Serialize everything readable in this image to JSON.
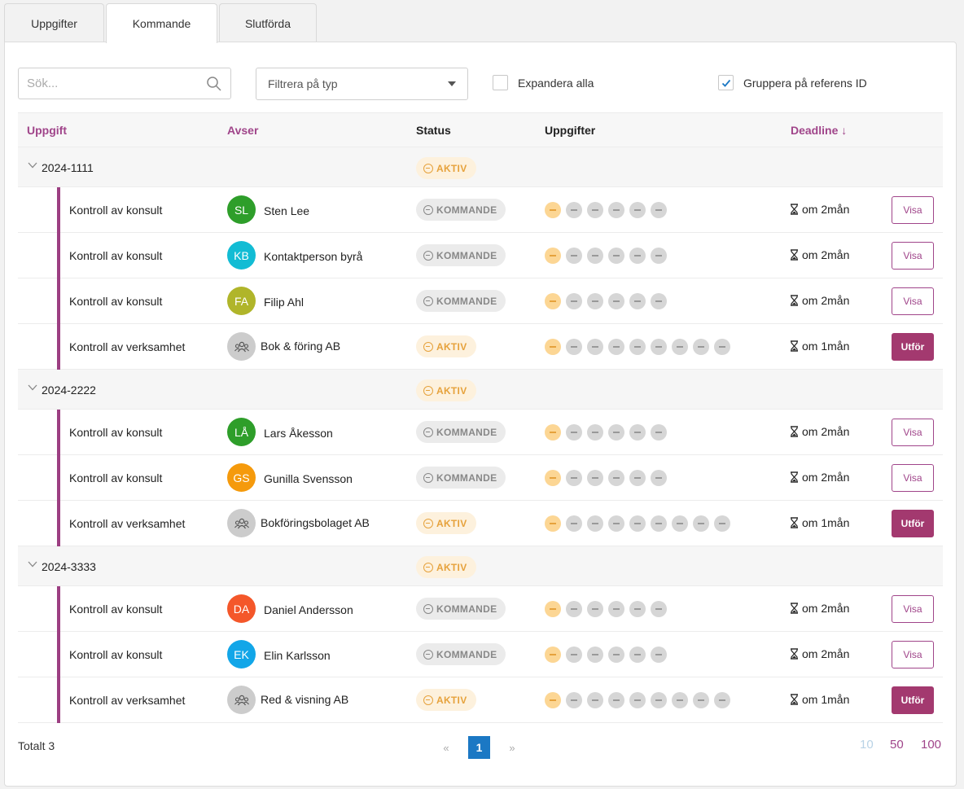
{
  "tabs": [
    {
      "label": "Uppgifter"
    },
    {
      "label": "Kommande"
    },
    {
      "label": "Slutförda"
    }
  ],
  "toolbar": {
    "search_placeholder": "Sök...",
    "filter_placeholder": "Filtrera på typ",
    "expand_all_label": "Expandera alla",
    "expand_all_checked": false,
    "group_by_label": "Gruppera på referens ID",
    "group_by_checked": true
  },
  "table": {
    "headers": {
      "task": "Uppgift",
      "regarding": "Avser",
      "status": "Status",
      "subtasks": "Uppgifter",
      "deadline": "Deadline ↓"
    },
    "groups": [
      {
        "id": "2024-1111",
        "status": "AKTIV",
        "rows": [
          {
            "task": "Kontroll av konsult",
            "initials": "SL",
            "avatar_color": "#2e9e2a",
            "name": "Sten Lee",
            "status": "KOMMANDE",
            "dots": 6,
            "deadline": "om 2mån",
            "action": "Visa"
          },
          {
            "task": "Kontroll av konsult",
            "initials": "KB",
            "avatar_color": "#12bcd4",
            "name": "Kontaktperson byrå",
            "status": "KOMMANDE",
            "dots": 6,
            "deadline": "om 2mån",
            "action": "Visa"
          },
          {
            "task": "Kontroll av konsult",
            "initials": "FA",
            "avatar_color": "#b0b52a",
            "name": "Filip Ahl",
            "status": "KOMMANDE",
            "dots": 6,
            "deadline": "om 2mån",
            "action": "Visa"
          },
          {
            "task": "Kontroll av verksamhet",
            "initials": "",
            "avatar_color": "#cccccc",
            "name": "Bok & föring AB",
            "status": "AKTIV",
            "dots": 9,
            "deadline": "om 1mån",
            "action": "Utför"
          }
        ]
      },
      {
        "id": "2024-2222",
        "status": "AKTIV",
        "rows": [
          {
            "task": "Kontroll av konsult",
            "initials": "LÅ",
            "avatar_color": "#2e9e2a",
            "name": "Lars Åkesson",
            "status": "KOMMANDE",
            "dots": 6,
            "deadline": "om 2mån",
            "action": "Visa"
          },
          {
            "task": "Kontroll av konsult",
            "initials": "GS",
            "avatar_color": "#f59a0c",
            "name": "Gunilla Svensson",
            "status": "KOMMANDE",
            "dots": 6,
            "deadline": "om 2mån",
            "action": "Visa"
          },
          {
            "task": "Kontroll av verksamhet",
            "initials": "",
            "avatar_color": "#cccccc",
            "name": "Bokföringsbolaget AB",
            "status": "AKTIV",
            "dots": 9,
            "deadline": "om 1mån",
            "action": "Utför"
          }
        ]
      },
      {
        "id": "2024-3333",
        "status": "AKTIV",
        "rows": [
          {
            "task": "Kontroll av konsult",
            "initials": "DA",
            "avatar_color": "#f4572a",
            "name": "Daniel Andersson",
            "status": "KOMMANDE",
            "dots": 6,
            "deadline": "om 2mån",
            "action": "Visa"
          },
          {
            "task": "Kontroll av konsult",
            "initials": "EK",
            "avatar_color": "#12a6e8",
            "name": "Elin Karlsson",
            "status": "KOMMANDE",
            "dots": 6,
            "deadline": "om 2mån",
            "action": "Visa"
          },
          {
            "task": "Kontroll av verksamhet",
            "initials": "",
            "avatar_color": "#cccccc",
            "name": "Red & visning AB",
            "status": "AKTIV",
            "dots": 9,
            "deadline": "om 1mån",
            "action": "Utför"
          }
        ]
      }
    ]
  },
  "footer": {
    "total": "Totalt 3",
    "prev": "«",
    "next": "»",
    "current_page": "1",
    "page_sizes": [
      {
        "label": "10",
        "color": "#b9d3e6"
      },
      {
        "label": "50",
        "color": "#a0458a"
      },
      {
        "label": "100",
        "color": "#a0458a"
      }
    ]
  }
}
